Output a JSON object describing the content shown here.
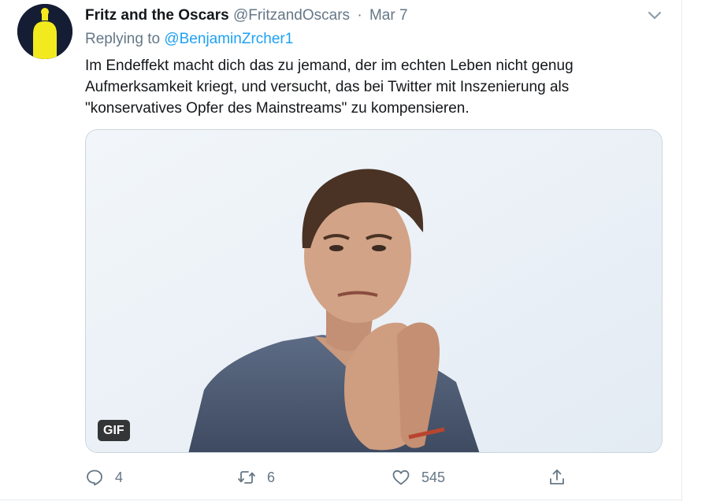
{
  "tweet": {
    "author_name": "Fritz and the Oscars",
    "author_handle": "@FritzandOscars",
    "separator": "·",
    "date": "Mar 7",
    "replying_prefix": "Replying to",
    "replying_to": "@BenjaminZrcher1",
    "text_lines": [
      "Im Endeffekt macht dich das zu jemand, der im echten Leben nicht genug",
      "Aufmerksamkeit kriegt, und versucht, das bei Twitter mit Inszenierung als",
      "\"konservatives Opfer des Mainstreams\" zu kompensieren."
    ]
  },
  "media": {
    "badge": "GIF"
  },
  "actions": {
    "reply_count": "4",
    "retweet_count": "6",
    "like_count": "545"
  },
  "icons": {
    "avatar": "yellow-silhouette-avatar",
    "menu": "chevron-down-icon",
    "reply": "reply-icon",
    "retweet": "retweet-icon",
    "like": "heart-icon",
    "share": "share-icon"
  },
  "colors": {
    "link": "#1da1f2",
    "muted": "#657786",
    "text": "#14171a",
    "avatar_bg": "#141d33",
    "avatar_figure": "#f2ea1f"
  }
}
